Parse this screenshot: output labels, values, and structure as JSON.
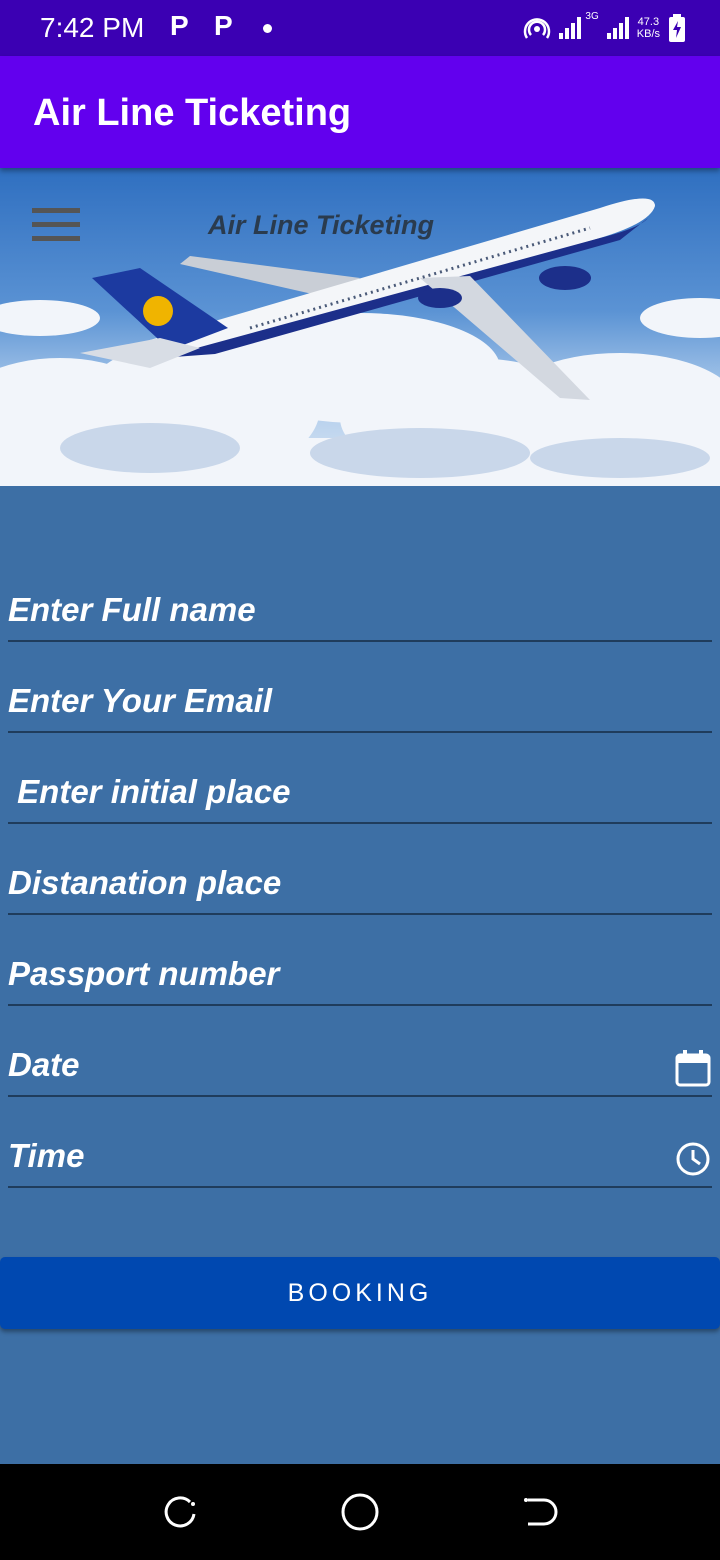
{
  "status_bar": {
    "time": "7:42 PM",
    "notif_icons": [
      "P",
      "P"
    ],
    "net_speed_value": "47.3",
    "net_speed_unit": "KB/s",
    "network_type": "3G"
  },
  "app_bar": {
    "title": "Air Line Ticketing"
  },
  "banner": {
    "title": "Air Line Ticketing",
    "menu_icon": "hamburger-menu-icon"
  },
  "form": {
    "full_name_placeholder": "Enter Full name",
    "email_placeholder": "Enter Your Email",
    "initial_place_placeholder": " Enter initial place",
    "destination_placeholder": "Distanation place",
    "passport_placeholder": "Passport number",
    "date_placeholder": "Date",
    "time_placeholder": "Time",
    "date_icon": "calendar-icon",
    "time_icon": "clock-icon"
  },
  "booking_button": {
    "label": "BOOKING"
  },
  "colors": {
    "status_bar": "#3b00b3",
    "app_bar": "#6200ee",
    "background": "#3d6fa5",
    "button": "#0048b0"
  }
}
